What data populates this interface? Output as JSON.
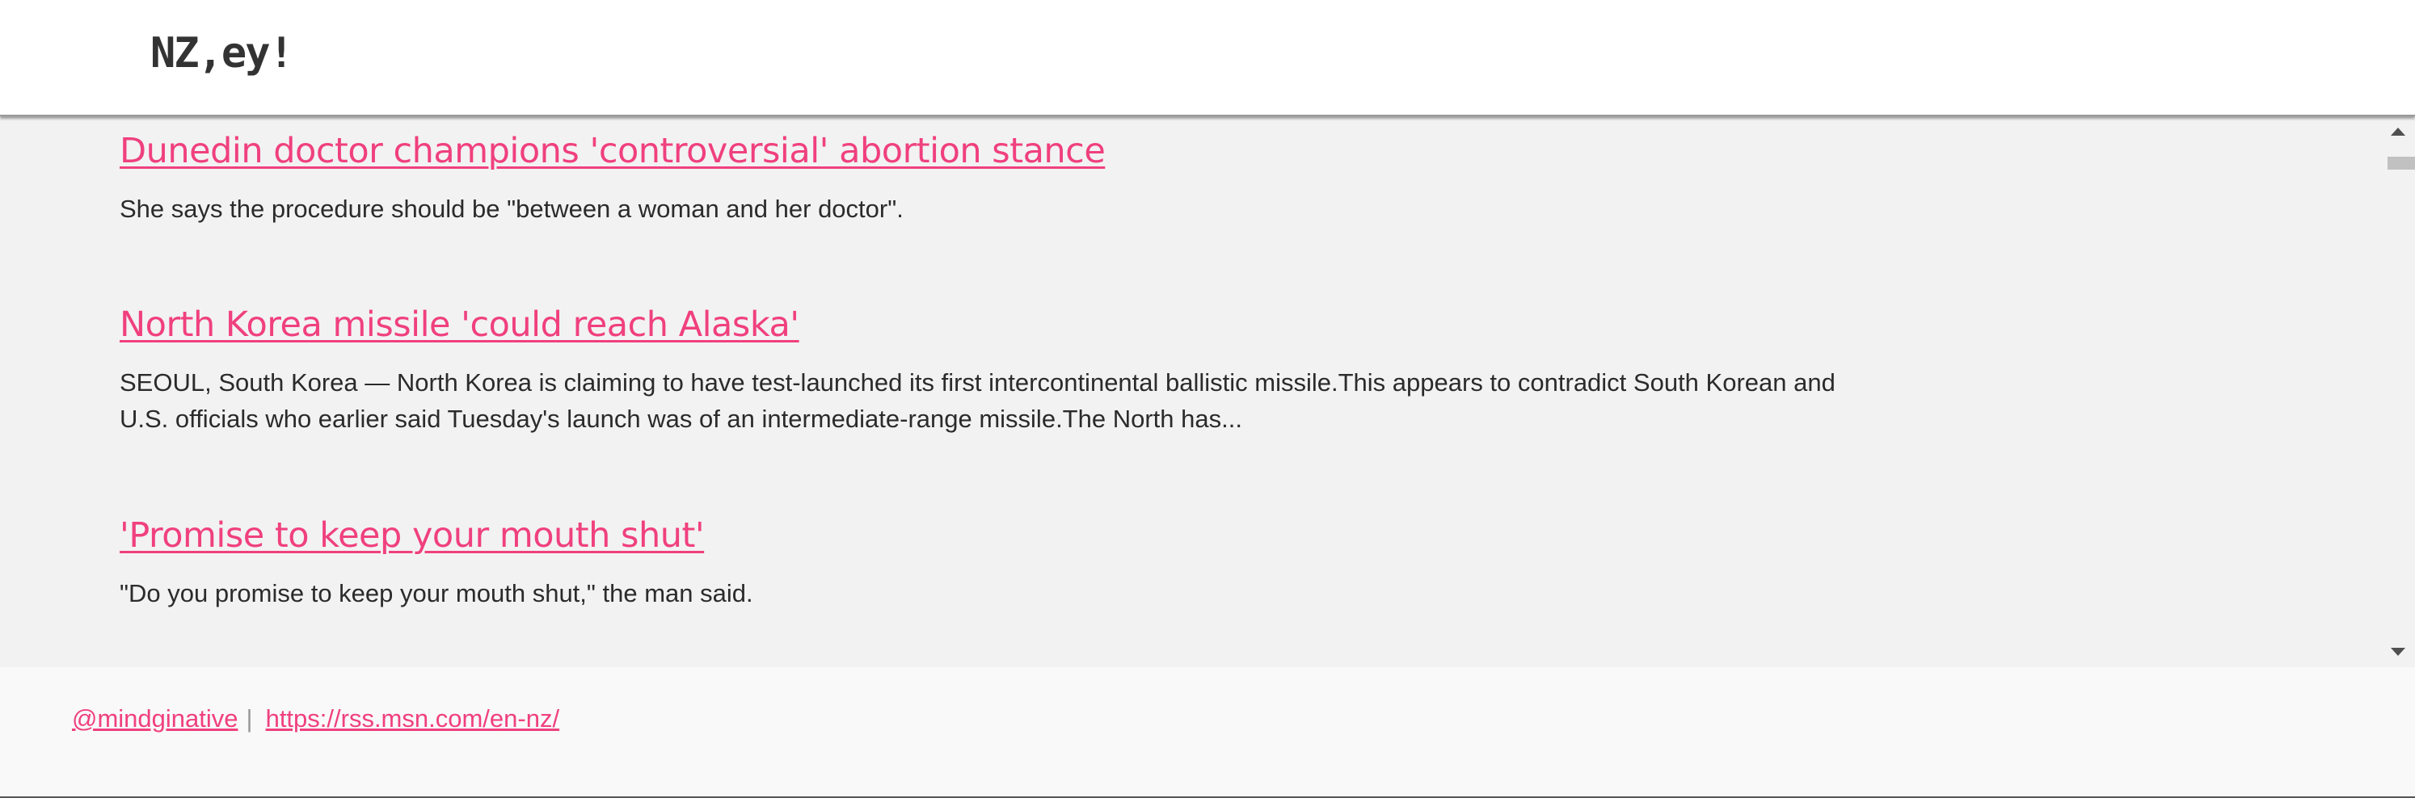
{
  "header": {
    "logo": "NZ,ey!"
  },
  "articles": [
    {
      "title": "Dunedin doctor champions 'controversial' abortion stance",
      "body": "She says the procedure should be \"between a woman and her doctor\"."
    },
    {
      "title": "North Korea missile 'could reach Alaska'",
      "body_lines": [
        "SEOUL, South Korea — North Korea is claiming to have test-launched its first intercontinental ballistic missile.This appears to contradict South Korean and",
        "U.S. officials who earlier said Tuesday's launch was of an intermediate-range missile.The North has..."
      ]
    },
    {
      "title": "'Promise to keep your mouth shut'",
      "body": "\"Do you promise to keep your mouth shut,\" the man said."
    }
  ],
  "footer": {
    "handle": "@mindginative",
    "separator": "|",
    "source_url": "https://rss.msn.com/en-nz/"
  },
  "colors": {
    "accent": "#f0407e",
    "content_bg": "#f2f2f2",
    "text": "#2b2b2b"
  }
}
